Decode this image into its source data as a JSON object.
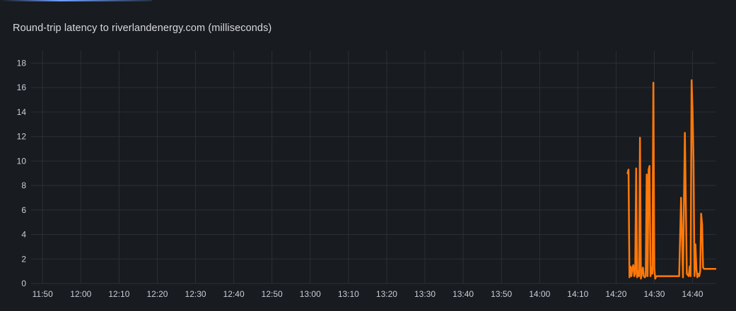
{
  "panel": {
    "title": "Round-trip latency to riverlandenergy.com (milliseconds)"
  },
  "colors": {
    "background": "#181b1f",
    "grid": "#2c2f36",
    "series": "#ff780a",
    "text": "#ccccdc"
  },
  "chart_data": {
    "type": "line",
    "title": "Round-trip latency to riverlandenergy.com (milliseconds)",
    "xlabel": "",
    "ylabel": "",
    "xlim": [
      "11:47",
      "14:46"
    ],
    "ylim": [
      0,
      19
    ],
    "grid": true,
    "legend": "none",
    "x_ticks": [
      "11:50",
      "12:00",
      "12:10",
      "12:20",
      "12:30",
      "12:40",
      "12:50",
      "13:00",
      "13:10",
      "13:20",
      "13:30",
      "13:40",
      "13:50",
      "14:00",
      "14:10",
      "14:20",
      "14:30",
      "14:40"
    ],
    "y_ticks": [
      0,
      2,
      4,
      6,
      8,
      10,
      12,
      14,
      16,
      18
    ],
    "series": [
      {
        "color": "#ff780a",
        "x": [
          "14:23:00",
          "14:23:15",
          "14:23:30",
          "14:23:45",
          "14:24:00",
          "14:24:15",
          "14:24:30",
          "14:24:45",
          "14:25:00",
          "14:25:15",
          "14:25:30",
          "14:25:45",
          "14:26:00",
          "14:26:15",
          "14:26:30",
          "14:26:45",
          "14:27:00",
          "14:27:15",
          "14:27:30",
          "14:27:45",
          "14:28:00",
          "14:28:15",
          "14:28:30",
          "14:28:45",
          "14:29:00",
          "14:29:15",
          "14:29:30",
          "14:29:45",
          "14:30:00",
          "14:30:15",
          "14:30:30",
          "14:30:45",
          "14:31:00",
          "14:31:15",
          "14:31:30",
          "14:31:45",
          "14:32:00",
          "14:32:15",
          "14:32:30",
          "14:32:45",
          "14:33:00",
          "14:33:15",
          "14:33:30",
          "14:33:45",
          "14:34:00",
          "14:34:15",
          "14:34:30",
          "14:34:45",
          "14:35:00",
          "14:35:30",
          "14:36:00",
          "14:36:30",
          "14:37:00",
          "14:37:30",
          "14:38:00",
          "14:38:30",
          "14:39:00",
          "14:39:15",
          "14:39:30",
          "14:39:45",
          "14:40:00",
          "14:40:15",
          "14:40:30",
          "14:40:45",
          "14:41:00",
          "14:41:15",
          "14:41:30",
          "14:41:45",
          "14:42:00",
          "14:42:15",
          "14:42:30",
          "14:42:45",
          "14:43:00",
          "14:43:15",
          "14:43:30",
          "14:43:45",
          "14:44:00",
          "14:44:15",
          "14:44:30",
          "14:44:45",
          "14:45:00",
          "14:45:15",
          "14:45:30",
          "14:45:45",
          "14:46:00"
        ],
        "values": [
          9.0,
          9.3,
          0.5,
          1.4,
          0.6,
          1.3,
          1.5,
          0.6,
          0.8,
          9.4,
          0.5,
          1.0,
          0.6,
          11.9,
          0.4,
          0.8,
          1.3,
          0.6,
          0.5,
          0.6,
          8.9,
          0.6,
          9.3,
          9.6,
          0.6,
          1.3,
          0.8,
          16.4,
          1.2,
          0.4,
          0.6,
          0.6,
          0.6,
          0.6,
          0.6,
          0.6,
          0.6,
          0.6,
          0.6,
          0.6,
          0.6,
          0.6,
          0.6,
          0.6,
          0.6,
          0.6,
          0.6,
          0.6,
          0.6,
          0.6,
          0.6,
          0.6,
          7.0,
          0.5,
          12.3,
          0.8,
          0.6,
          1.4,
          0.6,
          16.6,
          14.0,
          10.0,
          0.6,
          3.2,
          1.2,
          0.5,
          0.8,
          0.6,
          1.0,
          5.7,
          4.8,
          1.3,
          1.2,
          1.2,
          1.2,
          1.2,
          1.2,
          1.2,
          1.2,
          1.2,
          1.2,
          1.2,
          1.2,
          1.2,
          1.2
        ]
      }
    ]
  }
}
